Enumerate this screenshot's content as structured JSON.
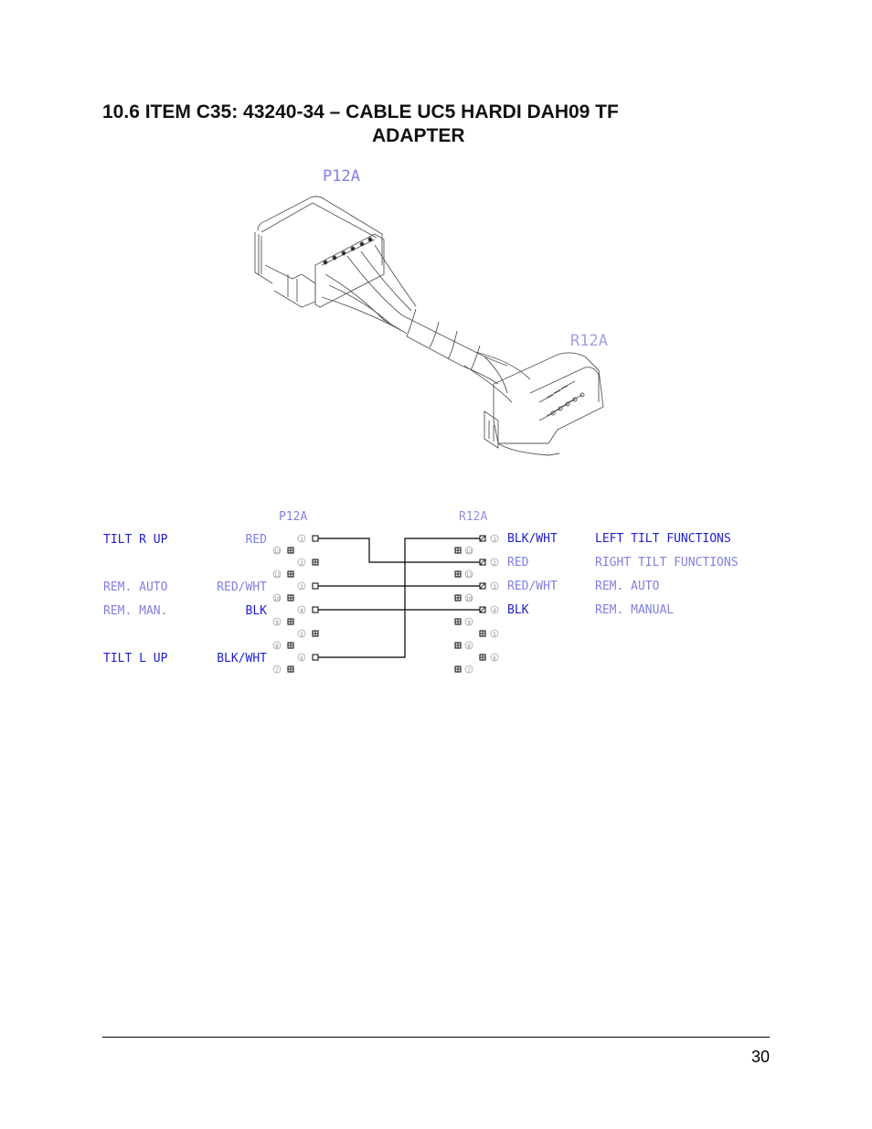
{
  "heading": {
    "line1": "10.6  ITEM C35:  43240-34 – CABLE UC5 HARDI DAH09 TF",
    "line2": "ADAPTER"
  },
  "illustration": {
    "connector_p_label": "P12A",
    "connector_r_label": "R12A"
  },
  "schematic": {
    "p_connector_label": "P12A",
    "r_connector_label": "R12A",
    "p_functions": [
      {
        "pin": "1",
        "function": "TILT R UP",
        "color": "RED"
      },
      {
        "pin": "3",
        "function": "REM. AUTO",
        "color": "RED/WHT"
      },
      {
        "pin": "4",
        "function": "REM. MAN.",
        "color": "BLK"
      },
      {
        "pin": "6",
        "function": "TILT L UP",
        "color": "BLK/WHT"
      }
    ],
    "p_pins": [
      "1",
      "12",
      "2",
      "11",
      "3",
      "10",
      "4",
      "9",
      "5",
      "8",
      "6",
      "7"
    ],
    "r_pins": [
      "1",
      "12",
      "2",
      "11",
      "3",
      "10",
      "4",
      "9",
      "5",
      "8",
      "6",
      "7"
    ],
    "r_functions": [
      {
        "pin": "1",
        "color": "BLK/WHT",
        "function": "LEFT TILT FUNCTIONS"
      },
      {
        "pin": "2",
        "color": "RED",
        "function": "RIGHT TILT FUNCTIONS"
      },
      {
        "pin": "3",
        "color": "RED/WHT",
        "function": "REM. AUTO"
      },
      {
        "pin": "4",
        "color": "BLK",
        "function": "REM. MANUAL"
      }
    ],
    "connections": [
      {
        "from": "P12A-1",
        "to": "R12A-2"
      },
      {
        "from": "P12A-3",
        "to": "R12A-3"
      },
      {
        "from": "P12A-4",
        "to": "R12A-4"
      },
      {
        "from": "P12A-6",
        "to": "R12A-1"
      }
    ]
  },
  "footer": {
    "page_number": "30"
  },
  "colors": {
    "cad_text": "#2020d0",
    "cad_text_light": "#9090e0"
  }
}
